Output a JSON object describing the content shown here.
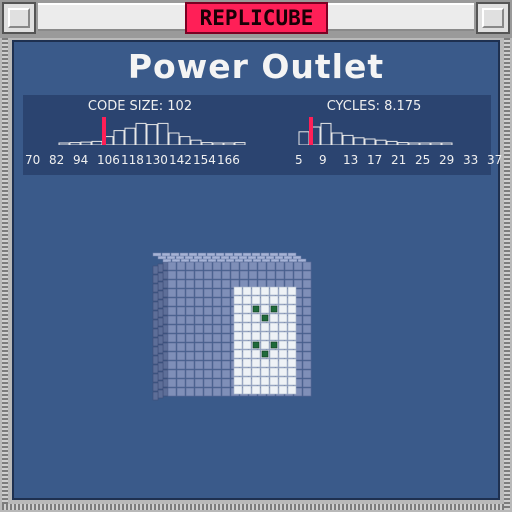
{
  "window": {
    "title_badge": "REPLICUBE",
    "accent_color": "#ff1f57",
    "panel_color": "#3a5a8a"
  },
  "puzzle": {
    "title": "Power Outlet"
  },
  "stats": {
    "code_size": {
      "label": "CODE SIZE: 102",
      "ticks": [
        "70",
        "82",
        "94",
        "106",
        "118",
        "130",
        "142",
        "154",
        "166"
      ],
      "histogram": [
        0.05,
        0.1,
        0.12,
        0.15,
        0.35,
        0.6,
        0.7,
        0.9,
        0.85,
        0.9,
        0.5,
        0.35,
        0.2,
        0.1,
        0.05,
        0.05,
        0.1
      ],
      "marker_index": 4
    },
    "cycles": {
      "label": "CYCLES: 8.175",
      "ticks": [
        "5",
        "9",
        "13",
        "17",
        "21",
        "25",
        "29",
        "33",
        "37"
      ],
      "histogram": [
        0.55,
        0.75,
        0.9,
        0.5,
        0.4,
        0.3,
        0.25,
        0.2,
        0.15,
        0.1,
        0.08,
        0.06,
        0.05,
        0.05
      ],
      "marker_index": 1
    }
  },
  "cube": {
    "subject": "power-outlet voxel model",
    "body_color": "#7f8fb8",
    "faceplate_color": "#eef2f6",
    "socket_color": "#1f6a3a"
  }
}
